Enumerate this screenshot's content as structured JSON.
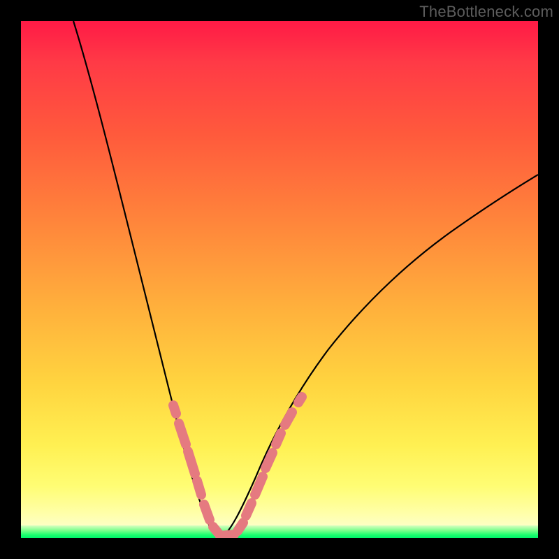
{
  "watermark": "TheBottleneck.com",
  "chart_data": {
    "type": "line",
    "title": "",
    "xlabel": "",
    "ylabel": "",
    "xlim": [
      0,
      100
    ],
    "ylim": [
      0,
      100
    ],
    "grid": false,
    "legend": false,
    "background": "vertical color gradient, red (top) to green (bottom), encoding bottleneck severity (red ~100%, green ~0%)",
    "series": [
      {
        "name": "left-curve",
        "stroke": "#000000",
        "x": [
          10.1,
          12.2,
          14.9,
          17.6,
          20.3,
          22.3,
          23.6,
          25.0,
          26.4,
          27.7,
          28.7,
          29.7,
          31.1,
          32.4,
          33.8,
          35.1,
          36.5,
          37.8
        ],
        "y": [
          100.0,
          93.2,
          82.4,
          70.3,
          56.8,
          45.9,
          39.2,
          32.4,
          25.7,
          20.3,
          16.2,
          12.2,
          8.1,
          5.4,
          3.4,
          2.0,
          1.1,
          0.5
        ]
      },
      {
        "name": "right-curve",
        "stroke": "#000000",
        "x": [
          37.8,
          39.2,
          40.5,
          41.9,
          43.2,
          45.9,
          48.6,
          52.7,
          56.8,
          60.8,
          66.2,
          71.6,
          77.0,
          83.8,
          90.5,
          97.3,
          100.0
        ],
        "y": [
          0.5,
          1.4,
          2.7,
          4.7,
          7.4,
          12.2,
          17.6,
          24.3,
          31.1,
          36.5,
          43.2,
          50.0,
          55.4,
          60.8,
          66.2,
          70.3,
          71.6
        ]
      }
    ],
    "markers": {
      "description": "pink rounded-segment markers along both curves near the bottom (low-bottleneck region)",
      "color": "#e57a80",
      "approx_y_range": [
        0,
        30
      ]
    }
  }
}
